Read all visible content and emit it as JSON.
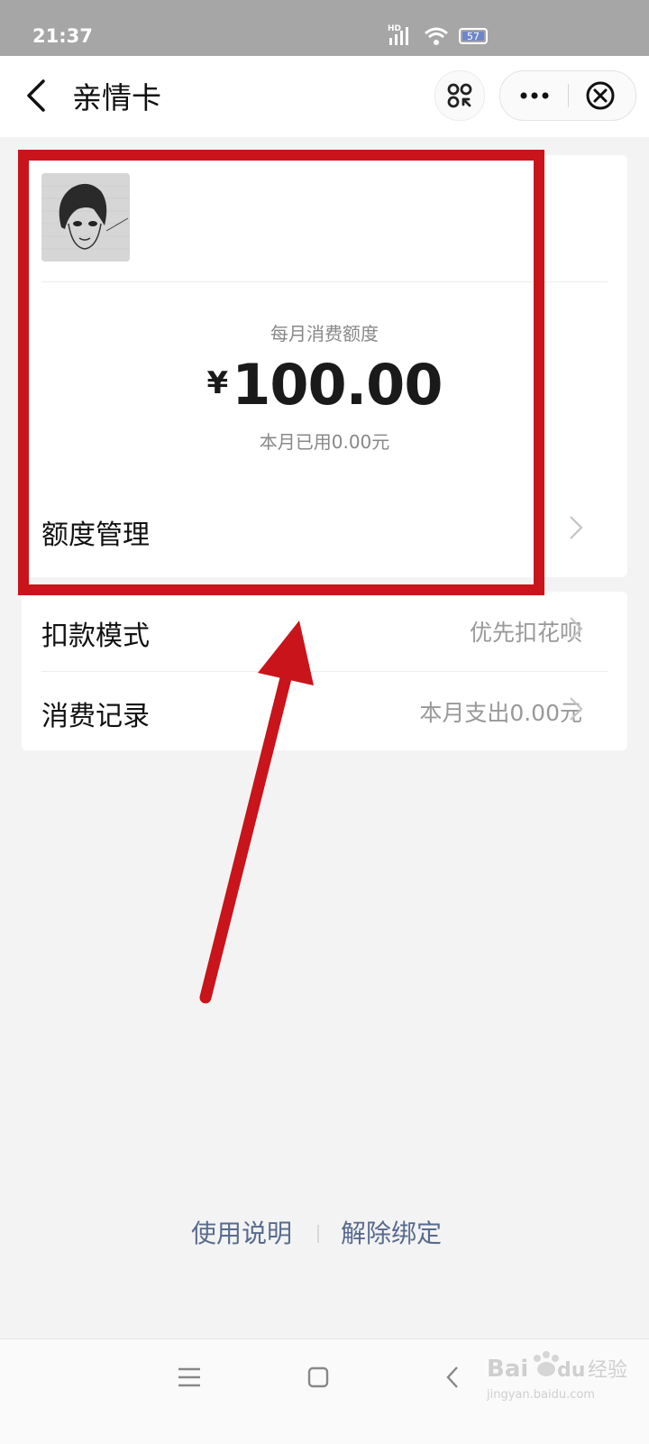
{
  "status_bar": {
    "time": "21:37",
    "network_label": "HD",
    "battery": "57",
    "icons": [
      "signal-icon",
      "wifi-icon",
      "battery-icon"
    ]
  },
  "nav": {
    "title": "亲情卡",
    "back_icon": "chevron-left-icon",
    "scan_icon": "mini-program-scan-icon",
    "more_icon": "more-dots-icon",
    "close_icon": "close-circle-icon"
  },
  "card": {
    "quota_label": "每月消费额度",
    "currency": "¥",
    "amount": "100.00",
    "used_text": "本月已用0.00元",
    "manage_label": "额度管理"
  },
  "rows": [
    {
      "label": "扣款模式",
      "value": "优先扣花呗"
    },
    {
      "label": "消费记录",
      "value": "本月支出0.00元"
    }
  ],
  "footer_links": {
    "instructions": "使用说明",
    "unbind": "解除绑定"
  },
  "system_nav": [
    "menu-icon",
    "home-icon",
    "back-icon"
  ],
  "watermark": {
    "line1": "Bai",
    "line2": "du",
    "line3": "经验",
    "url": "jingyan.baidu.com"
  },
  "colors": {
    "highlight_red": "#c8141a",
    "link_blue": "#586b8f",
    "background": "#f3f3f3"
  }
}
